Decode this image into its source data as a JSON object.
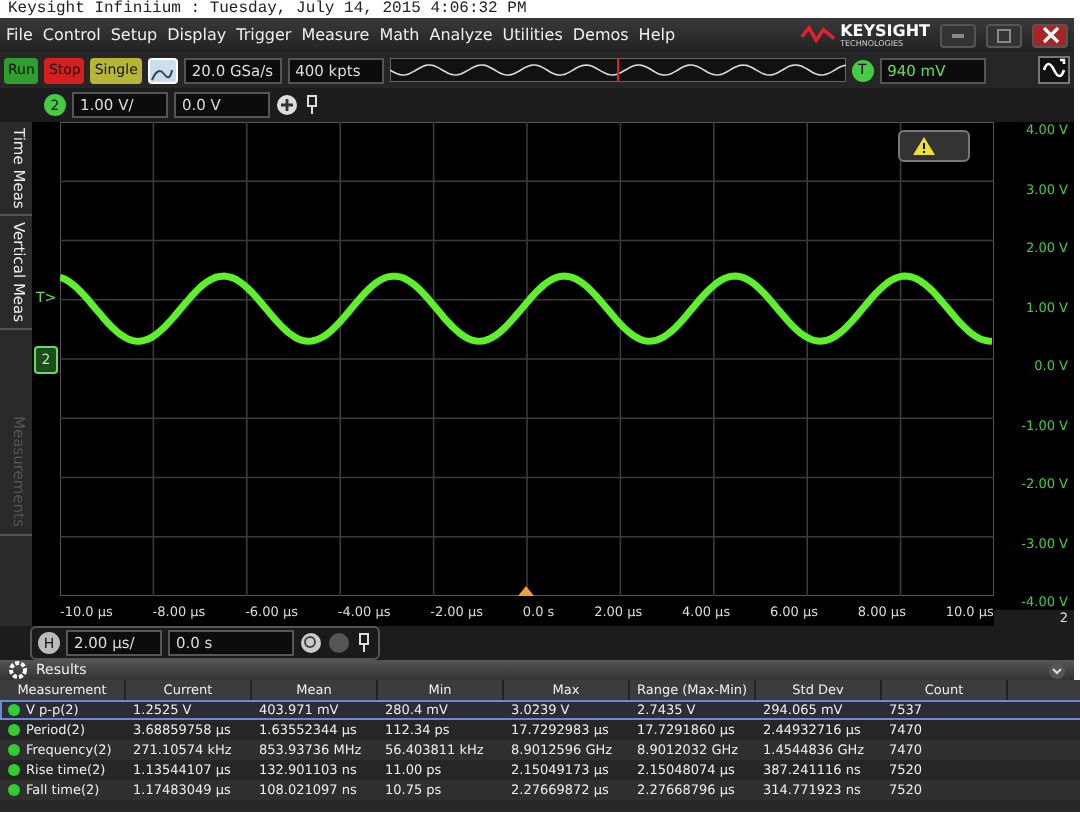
{
  "caption": "Keysight Infiniium : Tuesday, July 14, 2015 4:06:32 PM",
  "menu": [
    "File",
    "Control",
    "Setup",
    "Display",
    "Trigger",
    "Measure",
    "Math",
    "Analyze",
    "Utilities",
    "Demos",
    "Help"
  ],
  "logo": {
    "name": "KEYSIGHT",
    "tagline": "TECHNOLOGIES"
  },
  "acquisition_buttons": [
    {
      "label": "Run",
      "kind": "run"
    },
    {
      "label": "Stop",
      "kind": "stop"
    },
    {
      "label": "Single",
      "kind": "single"
    }
  ],
  "sample_rate": "20.0 GSa/s",
  "memory_depth": "400 kpts",
  "trigger": {
    "badge": "T",
    "level": "940 mV"
  },
  "channel": {
    "number": "2",
    "scale": "1.00 V/",
    "offset": "0.0 V"
  },
  "side_tabs": [
    {
      "label": "Time Meas",
      "disabled": false
    },
    {
      "label": "Vertical Meas",
      "disabled": false
    },
    {
      "label": "Measurements",
      "disabled": true
    }
  ],
  "plot_markers": {
    "trigger_level": "T>",
    "channel_ground": "2"
  },
  "y_labels": [
    "4.00 V",
    "3.00 V",
    "2.00 V",
    "1.00 V",
    "0.0 V",
    "-1.00 V",
    "-2.00 V",
    "-3.00 V",
    "-4.00 V"
  ],
  "x_labels": [
    "-10.0 µs",
    "-8.00 µs",
    "-6.00 µs",
    "-4.00 µs",
    "-2.00 µs",
    "0.0 s",
    "2.00 µs",
    "4.00 µs",
    "6.00 µs",
    "8.00 µs",
    "10.0 µs"
  ],
  "x_axis_channel": "2",
  "horizontal": {
    "badge": "H",
    "scale": "2.00 µs/",
    "position": "0.0 s"
  },
  "results": {
    "title": "Results",
    "columns": [
      "Measurement",
      "Current",
      "Mean",
      "Min",
      "Max",
      "Range (Max-Min)",
      "Std Dev",
      "Count"
    ],
    "rows": [
      {
        "selected": true,
        "cells": [
          "V p-p(2)",
          "1.2525 V",
          "403.971 mV",
          "280.4 mV",
          "3.0239 V",
          "2.7435 V",
          "294.065 mV",
          "7537"
        ]
      },
      {
        "selected": false,
        "cells": [
          "Period(2)",
          "3.68859758 µs",
          "1.63552344 µs",
          "112.34 ps",
          "17.7292983 µs",
          "17.7291860 µs",
          "2.44932716 µs",
          "7470"
        ]
      },
      {
        "selected": false,
        "cells": [
          "Frequency(2)",
          "271.10574 kHz",
          "853.93736 MHz",
          "56.403811 kHz",
          "8.9012596 GHz",
          "8.9012032 GHz",
          "1.4544836 GHz",
          "7470"
        ]
      },
      {
        "selected": false,
        "cells": [
          "Rise time(2)",
          "1.13544107 µs",
          "132.901103 ns",
          "11.00 ps",
          "2.15049173 µs",
          "2.15048074 µs",
          "387.241116 ns",
          "7520"
        ]
      },
      {
        "selected": false,
        "cells": [
          "Fall time(2)",
          "1.17483049 µs",
          "108.021097 ns",
          "10.75 ps",
          "2.27669872 µs",
          "2.27668796 µs",
          "314.771923 ns",
          "7520"
        ]
      }
    ]
  }
}
